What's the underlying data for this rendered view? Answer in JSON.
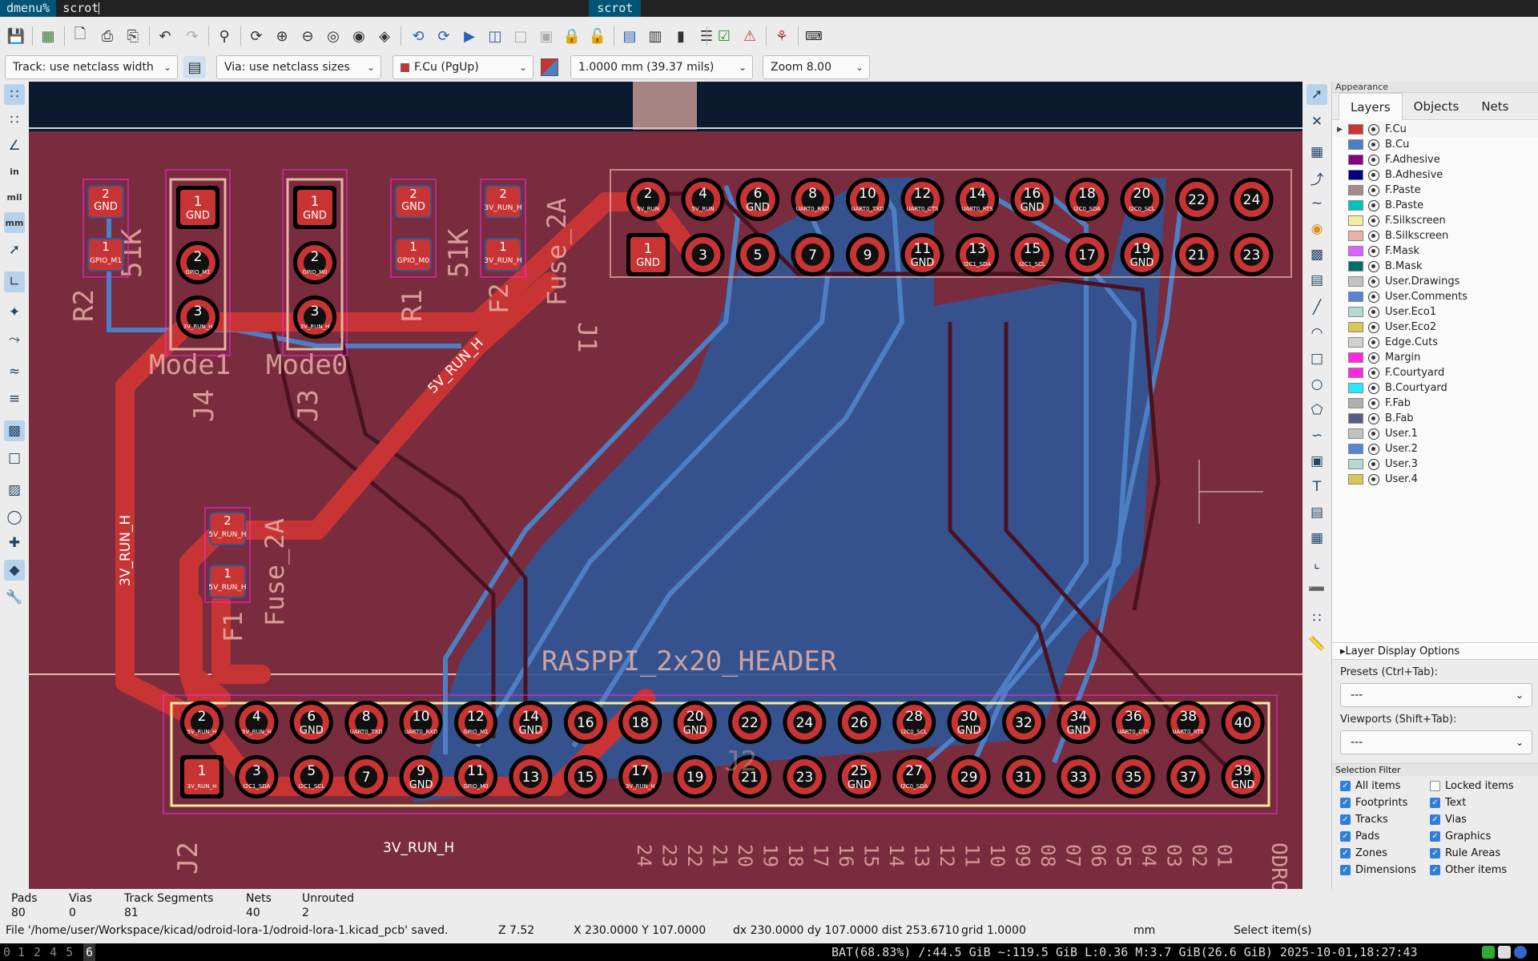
{
  "dmenu": {
    "prompt": "dmenu%",
    "input": "scrot",
    "match": "scrot"
  },
  "toolbar2": {
    "track_width": "Track: use netclass width",
    "via_size": "Via: use netclass sizes",
    "active_layer": "F.Cu (PgUp)",
    "grid": "1.0000 mm (39.37 mils)",
    "zoom": "Zoom 8.00"
  },
  "left_toolbar": {
    "units_in": "in",
    "units_mil": "mil",
    "units_mm": "mm"
  },
  "appearance": {
    "title": "Appearance",
    "tabs": [
      "Layers",
      "Objects",
      "Nets"
    ],
    "layers": [
      {
        "name": "F.Cu",
        "color": "#c83434"
      },
      {
        "name": "B.Cu",
        "color": "#4d7fc4"
      },
      {
        "name": "F.Adhesive",
        "color": "#84007d"
      },
      {
        "name": "B.Adhesive",
        "color": "#00007d"
      },
      {
        "name": "F.Paste",
        "color": "#a48a8a"
      },
      {
        "name": "B.Paste",
        "color": "#00c2c2"
      },
      {
        "name": "F.Silkscreen",
        "color": "#f2eda1"
      },
      {
        "name": "B.Silkscreen",
        "color": "#e8b2a7"
      },
      {
        "name": "F.Mask",
        "color": "#d864ff"
      },
      {
        "name": "B.Mask",
        "color": "#026d6d"
      },
      {
        "name": "User.Drawings",
        "color": "#c2c2c2"
      },
      {
        "name": "User.Comments",
        "color": "#5984d4"
      },
      {
        "name": "User.Eco1",
        "color": "#b4dbd2"
      },
      {
        "name": "User.Eco2",
        "color": "#d8c852"
      },
      {
        "name": "Edge.Cuts",
        "color": "#d0d2cd"
      },
      {
        "name": "Margin",
        "color": "#ff26e2"
      },
      {
        "name": "F.Courtyard",
        "color": "#ff26e2"
      },
      {
        "name": "B.Courtyard",
        "color": "#26e9ff"
      },
      {
        "name": "F.Fab",
        "color": "#afafaf"
      },
      {
        "name": "B.Fab",
        "color": "#585d84"
      },
      {
        "name": "User.1",
        "color": "#c2c2c2"
      },
      {
        "name": "User.2",
        "color": "#5984d4"
      },
      {
        "name": "User.3",
        "color": "#b4dbd2"
      },
      {
        "name": "User.4",
        "color": "#d8c852"
      }
    ],
    "layer_display_options": "Layer Display Options",
    "presets_label": "Presets (Ctrl+Tab):",
    "presets_value": "---",
    "viewports_label": "Viewports (Shift+Tab):",
    "viewports_value": "---",
    "selection_filter": "Selection Filter",
    "filters": [
      {
        "label": "All items",
        "checked": true
      },
      {
        "label": "Locked items",
        "checked": false
      },
      {
        "label": "Footprints",
        "checked": true
      },
      {
        "label": "Text",
        "checked": true
      },
      {
        "label": "Tracks",
        "checked": true
      },
      {
        "label": "Vias",
        "checked": true
      },
      {
        "label": "Pads",
        "checked": true
      },
      {
        "label": "Graphics",
        "checked": true
      },
      {
        "label": "Zones",
        "checked": true
      },
      {
        "label": "Rule Areas",
        "checked": true
      },
      {
        "label": "Dimensions",
        "checked": true
      },
      {
        "label": "Other items",
        "checked": true
      }
    ]
  },
  "board": {
    "silk_labels": [
      "Mode1",
      "Mode0",
      "J4",
      "J3",
      "J2",
      "J1",
      "R2",
      "R1",
      "51K",
      "51K",
      "Fuse_2A",
      "Fuse_2A",
      "F1",
      "F2",
      "RASPPI_2x20_HEADER",
      "ODRO"
    ],
    "net_labels": [
      "5V_RUN_H",
      "3V_RUN_H",
      "3V_RUN_H"
    ],
    "resistor_pads": [
      {
        "top": "2",
        "top_net": "GND",
        "bottom": "1",
        "bottom_net": "GPIO_M1"
      },
      {
        "top": "2",
        "top_net": "GND",
        "bottom": "1",
        "bottom_net": "GPIO_M0"
      },
      {
        "top": "2",
        "top_net": "3V_RUN_H",
        "bottom": "1",
        "bottom_net": "3V_RUN_H"
      }
    ],
    "jumper_pads": [
      {
        "p1": "1",
        "p1_net": "GND",
        "p2": "2",
        "p2_net": "GPIO_M1",
        "p3": "3",
        "p3_net": "3V_RUN_H"
      },
      {
        "p1": "1",
        "p1_net": "GND",
        "p2": "2",
        "p2_net": "GPIO_M0",
        "p3": "3",
        "p3_net": "3V_RUN_H"
      }
    ],
    "fuse_pads": {
      "p2": "2",
      "p2_net": "5V_RUN_H",
      "p1": "1",
      "p1_net": "5V_RUN_H"
    },
    "odroid_header_top": [
      "2",
      "4",
      "6",
      "8",
      "10",
      "12",
      "14",
      "16",
      "18",
      "20",
      "22",
      "24"
    ],
    "odroid_header_top_nets": [
      "5V_RUN",
      "5V_RUN",
      "GND",
      "UART0_RXD",
      "UART0_TXD",
      "UART0_CTS",
      "UART0_RTS",
      "GND",
      "I2C0_SDA",
      "I2C0_SCL",
      "",
      ""
    ],
    "odroid_header_bottom": [
      "1",
      "3",
      "5",
      "7",
      "9",
      "11",
      "13",
      "15",
      "17",
      "19",
      "21",
      "23"
    ],
    "odroid_header_bottom_nets": [
      "GND",
      "",
      "",
      "",
      "",
      "GND",
      "I2C1_SDA",
      "I2C1_SCL",
      "",
      "GND",
      "",
      ""
    ],
    "rpi_header_top": [
      "2",
      "4",
      "6",
      "8",
      "10",
      "12",
      "14",
      "16",
      "18",
      "20",
      "22",
      "24",
      "26",
      "28",
      "30",
      "32",
      "34",
      "36",
      "38",
      "40"
    ],
    "rpi_header_top_nets": [
      "5V_RUN_H",
      "5V_RUN_H",
      "GND",
      "UART0_TXD",
      "UART0_RXD",
      "GPIO_M1",
      "GND",
      "",
      "",
      "GND",
      "",
      "",
      "",
      "I2C0_SCL",
      "GND",
      "",
      "GND",
      "UART0_CTS",
      "UART0_RTS",
      ""
    ],
    "rpi_header_bottom": [
      "1",
      "3",
      "5",
      "7",
      "9",
      "11",
      "13",
      "15",
      "17",
      "19",
      "21",
      "23",
      "25",
      "27",
      "29",
      "31",
      "33",
      "35",
      "37",
      "39"
    ],
    "rpi_header_bottom_nets": [
      "3V_RUN_H",
      "I2C1_SDA",
      "I2C1_SCL",
      "",
      "GND",
      "GPIO_M0",
      "",
      "",
      "3V_RUN_H",
      "",
      "",
      "",
      "GND",
      "I2C0_SDA",
      "",
      "",
      "",
      "",
      "",
      "GND"
    ],
    "pin_numbers_rotated": [
      "24",
      "23",
      "22",
      "21",
      "20",
      "19",
      "18",
      "17",
      "16",
      "15",
      "14",
      "13",
      "12",
      "11",
      "10",
      "09",
      "08",
      "07",
      "06",
      "05",
      "04",
      "03",
      "02",
      "01"
    ],
    "ref_j2_silk": "J2"
  },
  "stats": {
    "pads_label": "Pads",
    "pads": "80",
    "vias_label": "Vias",
    "vias": "0",
    "tracks_label": "Track Segments",
    "tracks": "81",
    "nets_label": "Nets",
    "nets": "40",
    "unrouted_label": "Unrouted",
    "unrouted": "2"
  },
  "statusbar": {
    "file": "File '/home/user/Workspace/kicad/odroid-lora-1/odroid-lora-1.kicad_pcb' saved.",
    "z": "Z 7.52",
    "xy": "X 230.0000  Y 107.0000",
    "dxdy": "dx 230.0000  dy 107.0000  dist 253.6710",
    "grid": "grid 1.0000",
    "units": "mm",
    "mode": "Select item(s)"
  },
  "i3bar": {
    "workspaces": [
      "0",
      "1",
      "2",
      "4",
      "5",
      "6"
    ],
    "current_workspace": "6",
    "status": "BAT(68.83%) /:44.5 GiB ~:119.5 GiB L:0.36 M:3.7 GiB(26.6 GiB) 2025-10-01,18:27:43"
  }
}
